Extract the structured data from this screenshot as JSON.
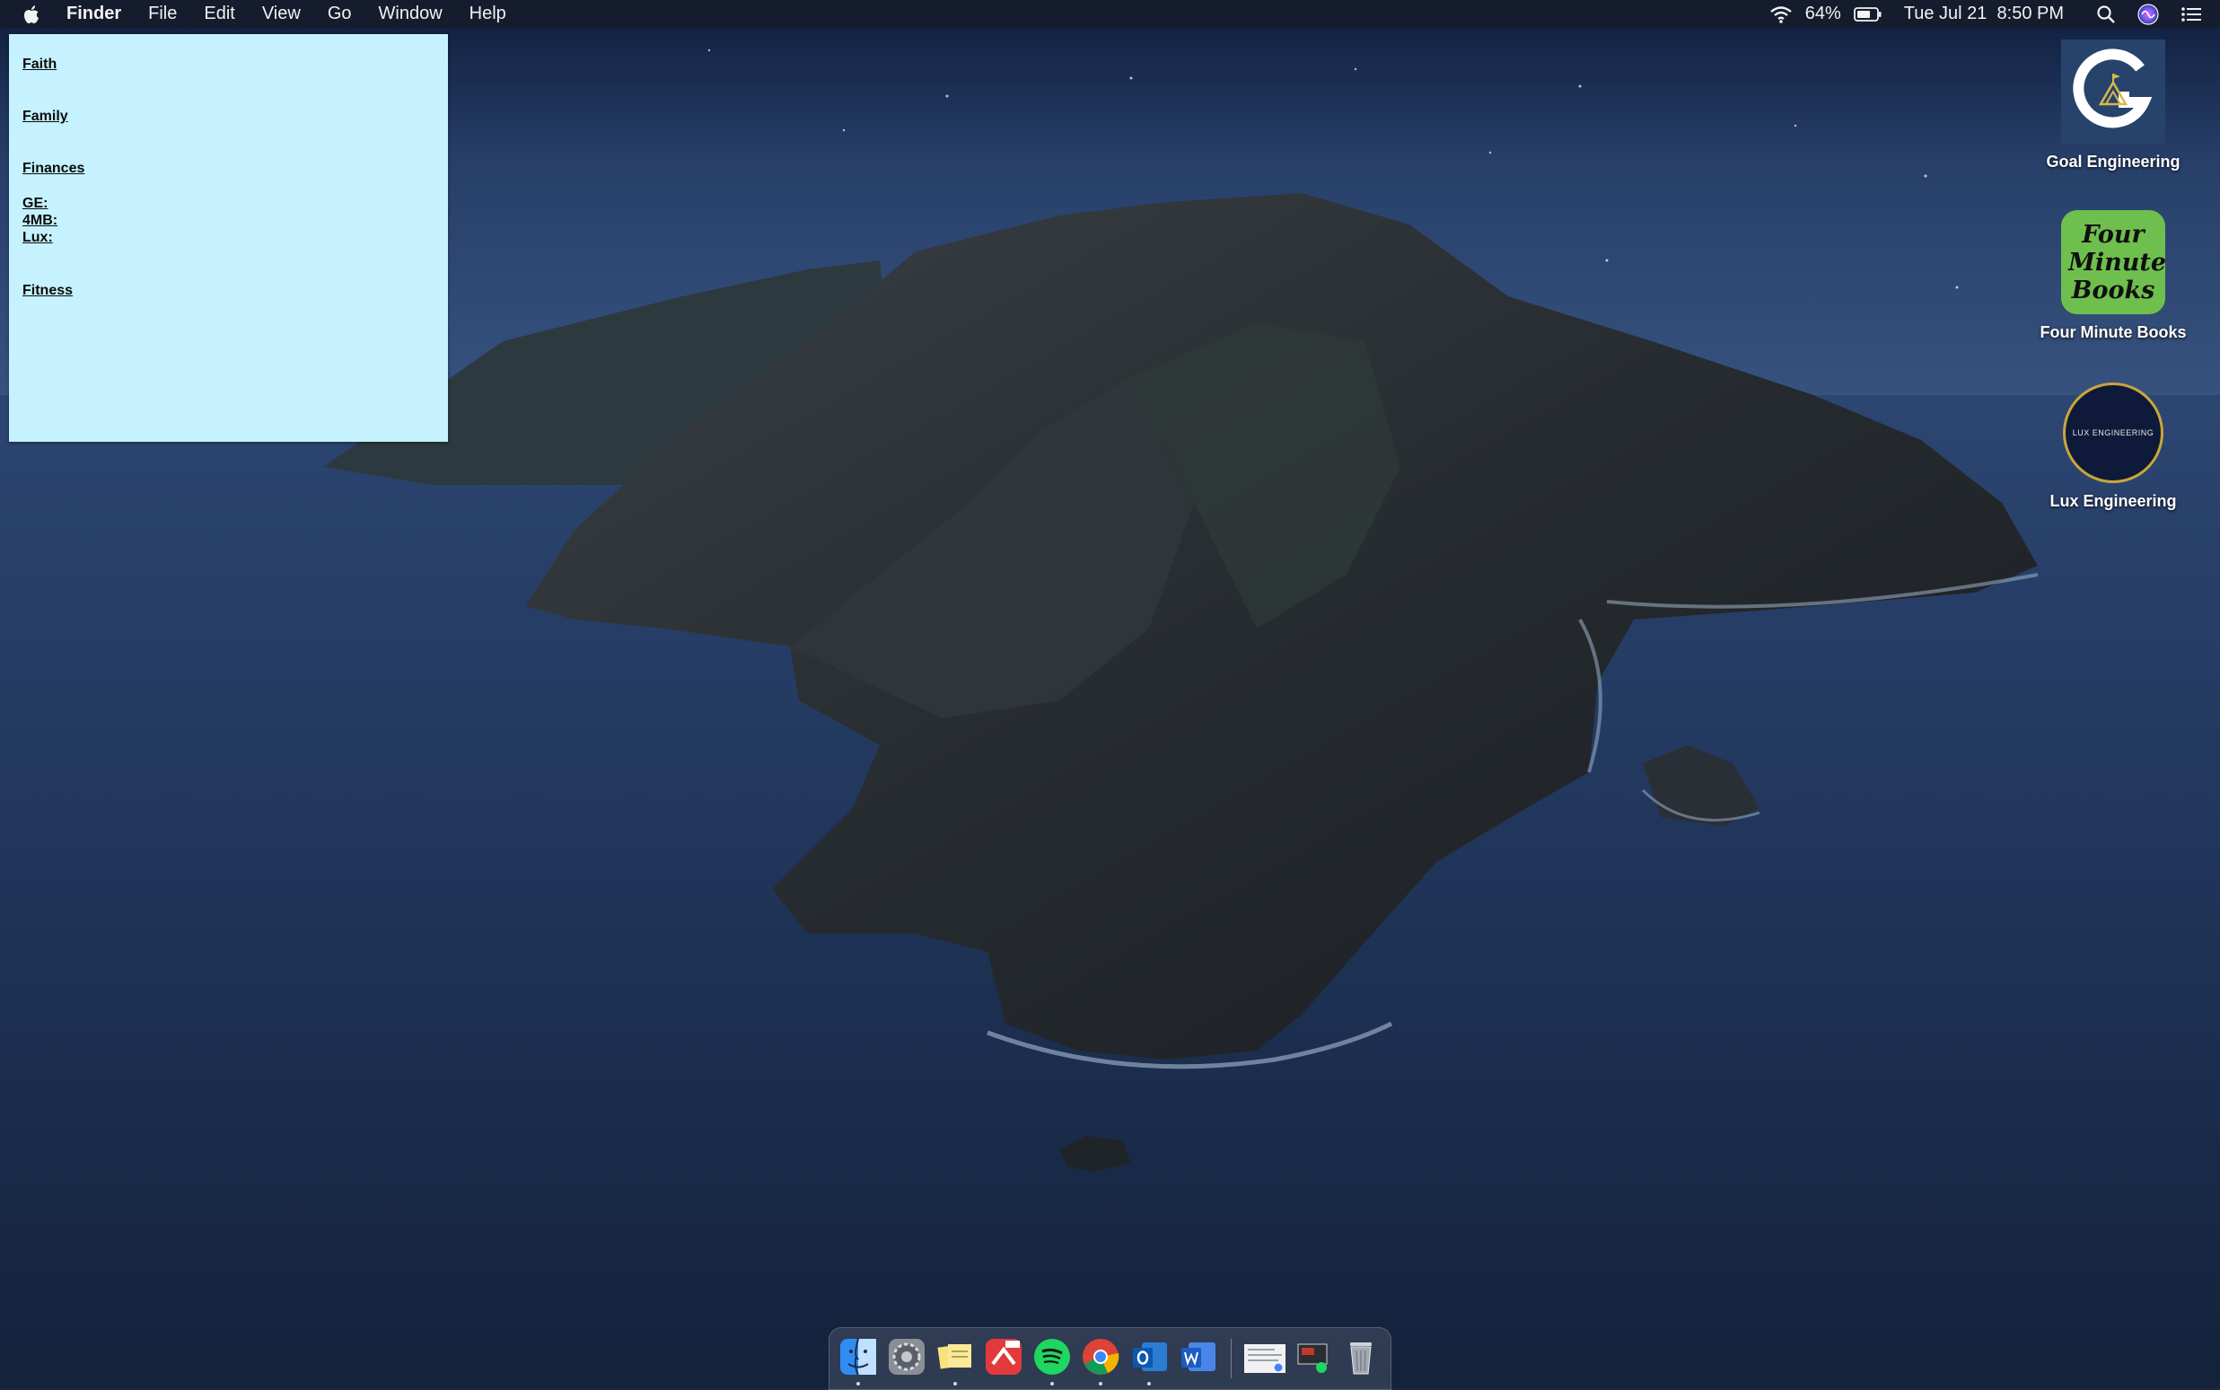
{
  "menubar": {
    "app_name": "Finder",
    "menus": [
      "File",
      "Edit",
      "View",
      "Go",
      "Window",
      "Help"
    ],
    "battery_percent": "64%",
    "datetime": "Tue Jul 21  8:50 PM"
  },
  "sticky_note": {
    "lines": [
      "Faith",
      "Family",
      "Finances",
      "GE:",
      "4MB:",
      "Lux:",
      "Fitness"
    ],
    "color": "#c5f2fe"
  },
  "desktop_icons": [
    {
      "label": "Goal Engineering",
      "icon": "goal-engineering-logo-icon"
    },
    {
      "label": "Four Minute Books",
      "icon": "four-minute-books-logo-icon",
      "logo_text": "Four Minute Books"
    },
    {
      "label": "Lux Engineering",
      "icon": "lux-engineering-logo-icon",
      "logo_text": "LUX ENGINEERING"
    }
  ],
  "dock": {
    "apps": [
      "finder-icon",
      "system-preferences-icon",
      "stickies-icon",
      "pdf-app-icon",
      "spotify-icon",
      "chrome-icon",
      "outlook-icon",
      "word-icon",
      "document-icon",
      "screenshot-stack-icon",
      "trash-icon"
    ]
  }
}
